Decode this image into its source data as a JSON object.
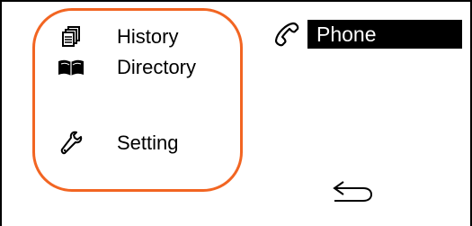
{
  "menu": {
    "items": [
      {
        "label": "History",
        "icon": "history-icon"
      },
      {
        "label": "Directory",
        "icon": "book-icon"
      },
      {
        "label": "Setting",
        "icon": "wrench-icon"
      }
    ]
  },
  "header": {
    "title": "Phone",
    "icon": "phone-handset-icon"
  },
  "back": {
    "icon": "back-arrow-icon"
  },
  "colors": {
    "highlight": "#f26522",
    "header_bg": "#000000",
    "header_text": "#ffffff"
  }
}
